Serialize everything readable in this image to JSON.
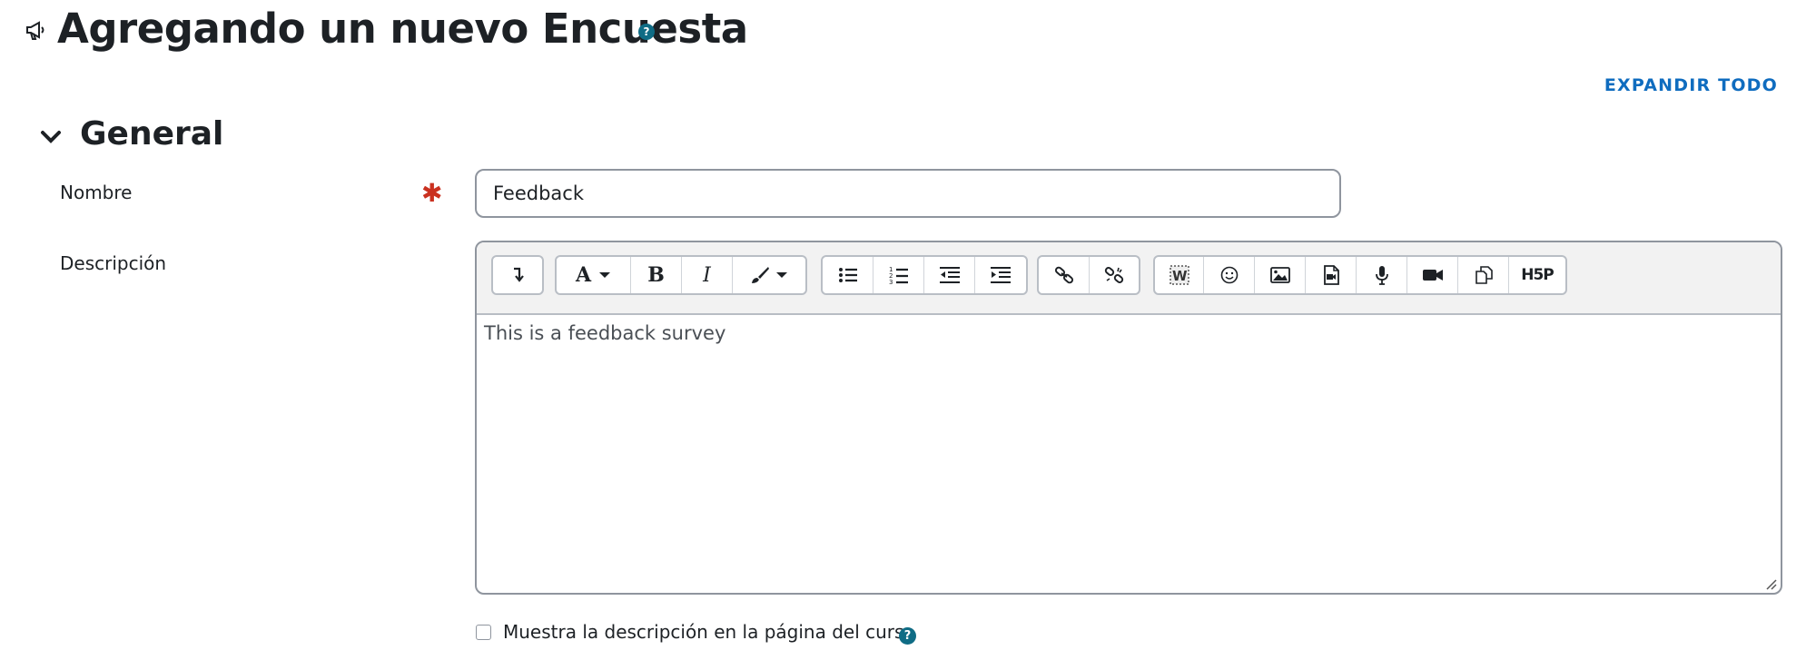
{
  "page": {
    "title": "Agregando un nuevo Encuesta",
    "icon": "megaphone-icon",
    "help_icon": "help-icon"
  },
  "actions": {
    "expand_all_label": "EXPANDIR TODO"
  },
  "section": {
    "title": "General",
    "toggle_icon": "chevron-down-icon",
    "expanded": true
  },
  "form": {
    "nombre": {
      "label": "Nombre",
      "required": true,
      "required_icon": "required-asterisk-icon",
      "value": "Feedback"
    },
    "descripcion": {
      "label": "Descripción",
      "content": "This is a feedback survey",
      "toolbar_groups": [
        [
          "toggle-toolbar"
        ],
        [
          "font-style",
          "bold",
          "italic",
          "text-color"
        ],
        [
          "unordered-list",
          "ordered-list",
          "outdent",
          "indent"
        ],
        [
          "link",
          "unlink"
        ],
        [
          "word-import",
          "emoji",
          "image",
          "media-file",
          "record-audio",
          "record-video",
          "manage-files",
          "h5p"
        ]
      ]
    },
    "show_description": {
      "label": "Muestra la descripción en la página del curso",
      "checked": false
    }
  },
  "colors": {
    "accent": "#0f6cbf",
    "help": "#0f6c85",
    "required": "#ca3120",
    "text": "#1d2125",
    "border": "#8f959e"
  }
}
